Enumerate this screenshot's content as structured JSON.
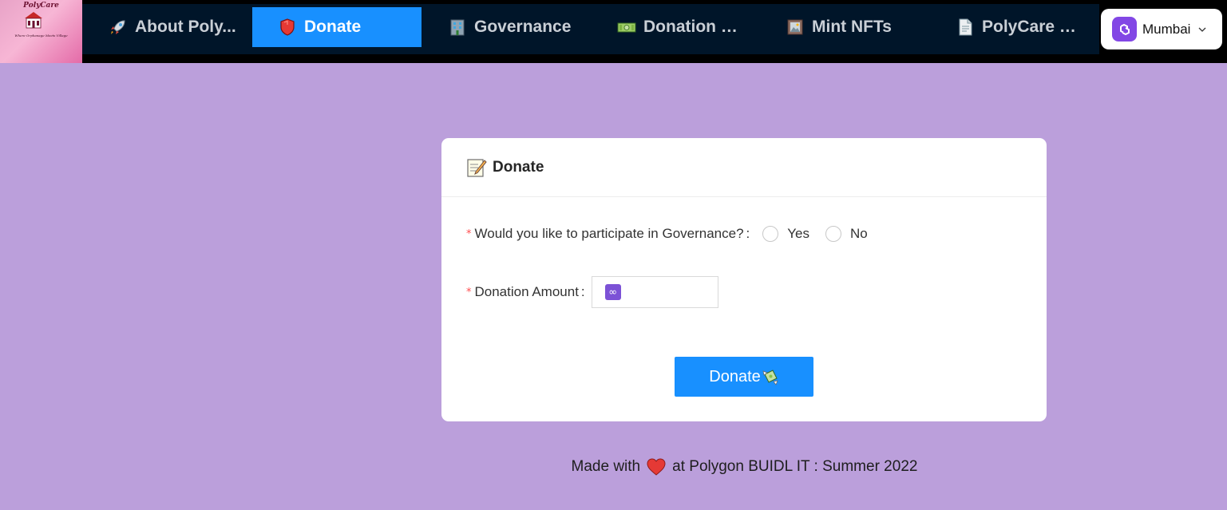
{
  "logo": {
    "title": "PolyCare",
    "tagline": "Where Orphanage Meets Village"
  },
  "nav": {
    "items": [
      {
        "label": "About Poly...",
        "icon": "rocket-icon",
        "active": false
      },
      {
        "label": "Donate",
        "icon": "shield-icon",
        "active": true
      },
      {
        "label": "Governance",
        "icon": "office-building-icon",
        "active": false
      },
      {
        "label": "Donation St...",
        "icon": "money-icon",
        "active": false
      },
      {
        "label": "Mint NFTs",
        "icon": "picture-frame-icon",
        "active": false
      },
      {
        "label": "PolyCare Co...",
        "icon": "document-icon",
        "active": false
      }
    ]
  },
  "network": {
    "label": "Mumbai"
  },
  "card": {
    "title": "Donate",
    "governance_question": "Would you like to participate in Governance?",
    "governance_options": [
      "Yes",
      "No"
    ],
    "amount_label": "Donation Amount",
    "amount_value": "",
    "submit_label": "Donate"
  },
  "footer": {
    "prefix": "Made with",
    "suffix": "at Polygon BUIDL IT : Summer 2022"
  },
  "colors": {
    "background": "#bb9fdb",
    "nav_bg": "#001529",
    "accent": "#1890ff",
    "polygon_purple": "#8247e5",
    "required": "#ff4d4f"
  }
}
